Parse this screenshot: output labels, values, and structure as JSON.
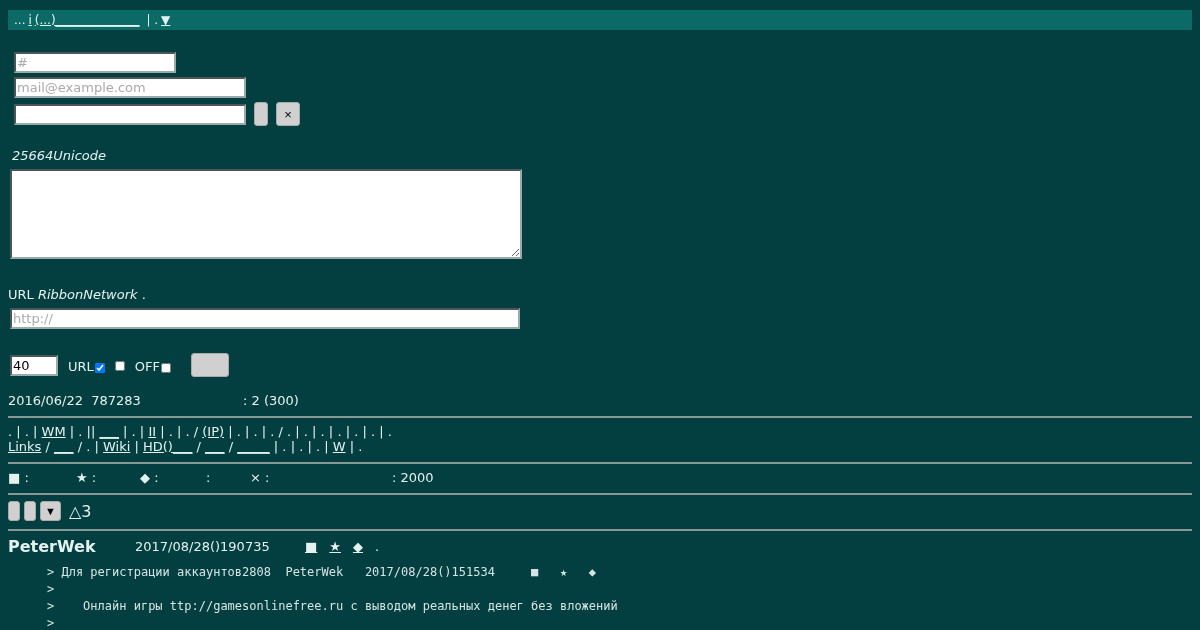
{
  "top_bar": [
    {
      "text": "...",
      "kind": "text"
    },
    {
      "text": "i",
      "kind": "link"
    },
    {
      "text": "(...)______________",
      "kind": "link"
    },
    {
      "text": " | .",
      "kind": "text"
    },
    {
      "text": "▼",
      "kind": "link"
    }
  ],
  "form": {
    "number_field": {
      "placeholder": "#"
    },
    "email_field": {
      "placeholder": "mail@example.com"
    },
    "close_button": "×",
    "comment_label": "*25664Unicode*",
    "url_label": "URL *RibbonNetwork*   .",
    "url_field": {
      "placeholder": "http://"
    },
    "size_field": {
      "value": "40"
    },
    "options": [
      {
        "label": "URL",
        "checked": true
      },
      {
        "checked": false
      },
      {
        "label": "OFF",
        "checked": false
      }
    ]
  },
  "info": {
    "date": "2016/06/22  787283",
    "count": ": 2 (300)"
  },
  "nav_lines": [
    [
      {
        "text": ". | . | ",
        "kind": "text"
      },
      {
        "text": "WM",
        "kind": "link"
      },
      {
        "text": " | . || ",
        "kind": "text"
      },
      {
        "text": "___",
        "kind": "link"
      },
      {
        "text": " | . | ",
        "kind": "text"
      },
      {
        "text": "II",
        "kind": "link"
      },
      {
        "text": " | . | . / ",
        "kind": "text"
      },
      {
        "text": "(IP)",
        "kind": "link"
      },
      {
        "text": " | . | . | . / . | . | . | . | . | . | .",
        "kind": "text"
      }
    ],
    [
      {
        "text": "Links",
        "kind": "link"
      },
      {
        "text": " / ",
        "kind": "text"
      },
      {
        "text": "___",
        "kind": "link"
      },
      {
        "text": " / . | ",
        "kind": "text"
      },
      {
        "text": "Wiki",
        "kind": "link"
      },
      {
        "text": " | ",
        "kind": "text"
      },
      {
        "text": "HD()___",
        "kind": "link"
      },
      {
        "text": " / ",
        "kind": "text"
      },
      {
        "text": "___",
        "kind": "link"
      },
      {
        "text": " / ",
        "kind": "text"
      },
      {
        "text": "_____",
        "kind": "link"
      },
      {
        "text": " | . | . | . | ",
        "kind": "text"
      },
      {
        "text": "W",
        "kind": "link"
      },
      {
        "text": " | .",
        "kind": "text"
      }
    ]
  ],
  "legend": [
    "■ :",
    "★ :",
    "◆ :",
    ":",
    "× :",
    ": 2000"
  ],
  "toolbar": {
    "dropdown": "▼",
    "counter": "△3"
  },
  "post": {
    "author": "PeterWek",
    "date": "2017/08/28()190735",
    "actions": [
      "■",
      "★",
      "◆"
    ],
    "dot": ".",
    "quote_lines": [
      "> Для регистрации аккаунтов2808  PeterWek   2017/08/28()151534     ■   ★   ◆",
      ">",
      ">    Онлайн игры ttp://gamesonlinefree.ru с выводом реальных денег без вложений",
      ">"
    ]
  }
}
